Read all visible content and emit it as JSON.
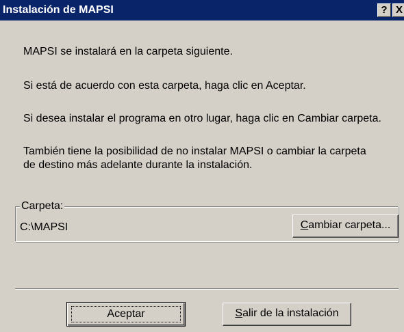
{
  "window": {
    "title": "Instalación de MAPSI",
    "help_button": "?",
    "close_button": "X"
  },
  "messages": {
    "line1": "MAPSI se instalará en la carpeta siguiente.",
    "line2": "Si está de acuerdo con esta carpeta, haga clic en Aceptar.",
    "line3": "Si desea instalar el programa en otro lugar, haga clic en Cambiar carpeta.",
    "line4": "También tiene la posibilidad de no instalar MAPSI o cambiar la carpeta de destino más adelante durante la instalación."
  },
  "folder_group": {
    "legend": "Carpeta:",
    "path": "C:\\MAPSI",
    "change_button": {
      "mnemonic": "C",
      "rest": "ambiar carpeta..."
    }
  },
  "buttons": {
    "accept": "Aceptar",
    "exit": {
      "mnemonic": "S",
      "rest": "alir de la instalación"
    }
  }
}
